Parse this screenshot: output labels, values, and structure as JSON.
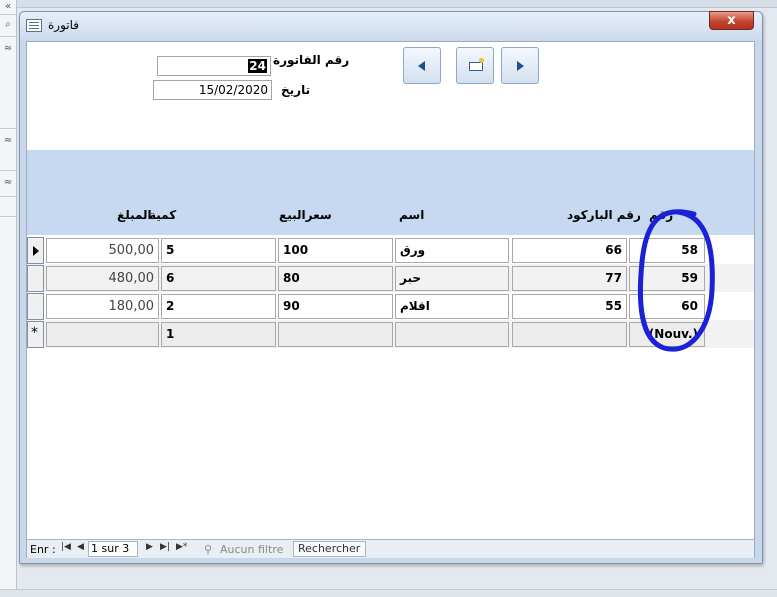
{
  "window": {
    "title": "فاتورة",
    "close_label": "x"
  },
  "header": {
    "invoice_label": "رقم الفاتورة",
    "invoice_value": "24",
    "date_label": "تاريخ",
    "date_value": "15/02/2020"
  },
  "columns": {
    "number": "رقم",
    "barcode": "رقم الباركود",
    "name": "اسم",
    "price": "سعرالبيع",
    "quantity": "كمية",
    "amount": "المبلغ"
  },
  "rows": [
    {
      "number": "58",
      "barcode": "66",
      "name": "ورق",
      "price": "100",
      "quantity": "5",
      "amount": "500,00"
    },
    {
      "number": "59",
      "barcode": "77",
      "name": "حبر",
      "price": "80",
      "quantity": "6",
      "amount": "480,00"
    },
    {
      "number": "60",
      "barcode": "55",
      "name": "اقلام",
      "price": "90",
      "quantity": "2",
      "amount": "180,00"
    }
  ],
  "new_row": {
    "number": "(Nouv.)",
    "quantity": "1"
  },
  "status": {
    "records_label": "Enr :",
    "position": "1 sur 3",
    "filter": "Aucun filtre",
    "search": "Rechercher"
  },
  "left_strip": {
    "collapse_glyph": "«",
    "search_glyph": "⌕",
    "chevron_glyph": "≈"
  },
  "colors": {
    "accent": "#c6d9f1",
    "annotation": "#1b21d6",
    "close": "#c24530"
  },
  "icons": [
    "nav-previous-icon",
    "new-record-icon",
    "nav-next-icon",
    "close-icon",
    "form-icon",
    "filter-icon"
  ]
}
